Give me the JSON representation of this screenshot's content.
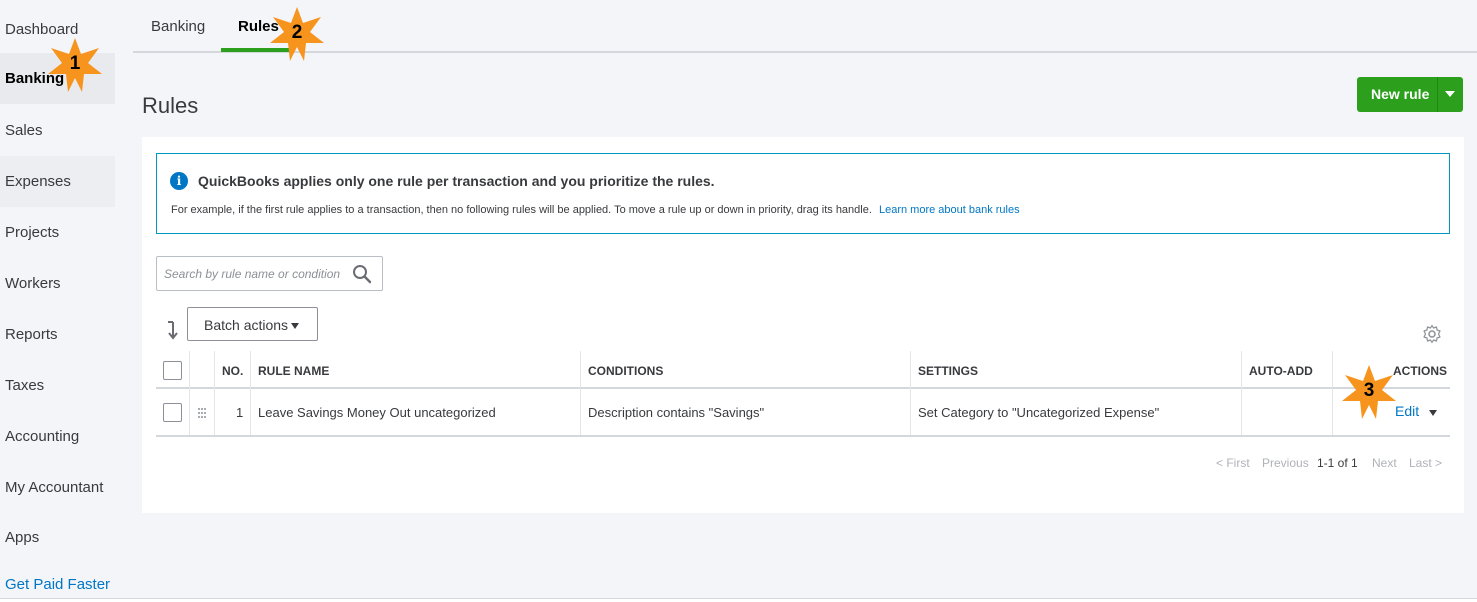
{
  "sidebar": {
    "items": [
      {
        "label": "Dashboard"
      },
      {
        "label": "Banking"
      },
      {
        "label": "Sales"
      },
      {
        "label": "Expenses"
      },
      {
        "label": "Projects"
      },
      {
        "label": "Workers"
      },
      {
        "label": "Reports"
      },
      {
        "label": "Taxes"
      },
      {
        "label": "Accounting"
      },
      {
        "label": "My Accountant"
      },
      {
        "label": "Apps"
      }
    ],
    "promo_link": "Get Paid Faster"
  },
  "tabs": [
    {
      "label": "Banking"
    },
    {
      "label": "Rules"
    }
  ],
  "page": {
    "title": "Rules",
    "new_rule_label": "New rule"
  },
  "info": {
    "icon": "info-icon",
    "title": "QuickBooks applies only one rule per transaction and you prioritize the rules.",
    "body": "For example, if the first rule applies to a transaction, then no following rules will be applied. To move a rule up or down in priority, drag its handle.",
    "link": "Learn more about bank rules"
  },
  "search": {
    "placeholder": "Search by rule name or condition"
  },
  "toolbar": {
    "batch_label": "Batch actions"
  },
  "table": {
    "headers": {
      "no": "NO.",
      "rule_name": "RULE NAME",
      "conditions": "CONDITIONS",
      "settings": "SETTINGS",
      "auto_add": "AUTO-ADD",
      "actions": "ACTIONS"
    },
    "rows": [
      {
        "no": "1",
        "rule_name": "Leave Savings Money Out uncategorized",
        "conditions": "Description contains \"Savings\"",
        "settings": "Set Category to \"Uncategorized Expense\"",
        "auto_add": "",
        "action": "Edit"
      }
    ]
  },
  "pager": {
    "first": "< First",
    "previous": "Previous",
    "range": "1-1 of 1",
    "next": "Next",
    "last": "Last >"
  },
  "annotations": [
    "1",
    "2",
    "3"
  ],
  "colors": {
    "accent_green": "#2ca01c",
    "link_blue": "#0077c5",
    "info_border": "#0097c2",
    "annotation_star": "#f7941d"
  }
}
